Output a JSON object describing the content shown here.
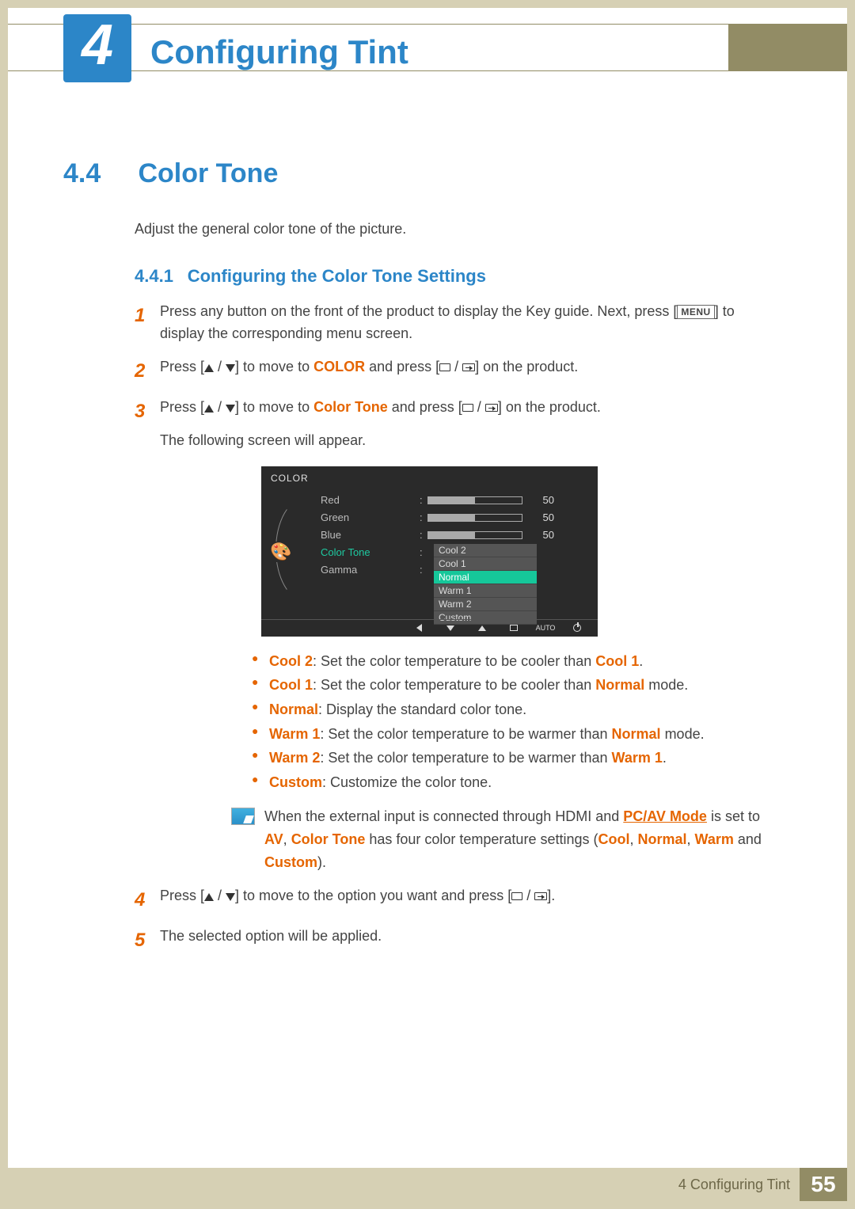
{
  "chapter": {
    "number": "4",
    "title": "Configuring Tint"
  },
  "section": {
    "number": "4.4",
    "title": "Color Tone"
  },
  "intro": "Adjust the general color tone of the picture.",
  "subsection": {
    "number": "4.4.1",
    "title": "Configuring the Color Tone Settings"
  },
  "steps": {
    "s1": {
      "num": "1",
      "a": "Press any button on the front of the product to display the Key guide. Next, press [",
      "menu": "MENU",
      "b": "] to display the corresponding menu screen."
    },
    "s2": {
      "num": "2",
      "a": "Press [",
      "b": "] to move to ",
      "c": "COLOR",
      "d": " and press [",
      "e": "] on the product."
    },
    "s3": {
      "num": "3",
      "a": "Press [",
      "b": "] to move to ",
      "c": "Color Tone",
      "d": " and press [",
      "e": "] on the product.",
      "f": "The following screen will appear."
    },
    "s4": {
      "num": "4",
      "a": "Press [",
      "b": "] to move to the option you want and press [",
      "c": "]."
    },
    "s5": {
      "num": "5",
      "a": "The selected option will be applied."
    }
  },
  "osd": {
    "title": "COLOR",
    "rows": [
      {
        "label": "Red",
        "value": "50"
      },
      {
        "label": "Green",
        "value": "50"
      },
      {
        "label": "Blue",
        "value": "50"
      }
    ],
    "sel_label": "Color Tone",
    "gamma_label": "Gamma",
    "options": [
      "Cool 2",
      "Cool 1",
      "Normal",
      "Warm 1",
      "Warm 2",
      "Custom"
    ],
    "selected": "Normal",
    "auto": "AUTO"
  },
  "bullets": {
    "b1": {
      "t": "Cool 2",
      "a": ": Set the color temperature to be cooler than ",
      "r": "Cool 1",
      "z": "."
    },
    "b2": {
      "t": "Cool 1",
      "a": ": Set the color temperature to be cooler than ",
      "r": "Normal",
      "z": " mode."
    },
    "b3": {
      "t": "Normal",
      "a": ": Display the standard color tone.",
      "r": "",
      "z": ""
    },
    "b4": {
      "t": "Warm 1",
      "a": ": Set the color temperature to be warmer than ",
      "r": "Normal",
      "z": " mode."
    },
    "b5": {
      "t": "Warm 2",
      "a": ": Set the color temperature to be warmer than ",
      "r": "Warm 1",
      "z": "."
    },
    "b6": {
      "t": "Custom",
      "a": ": Customize the color tone.",
      "r": "",
      "z": ""
    }
  },
  "note": {
    "a": "When the external input is connected through HDMI and ",
    "b": "PC/AV Mode",
    "c": " is set to ",
    "d": "AV",
    "e": ", ",
    "f": "Color Tone",
    "g": " has four color temperature settings (",
    "h": "Cool",
    "i": ", ",
    "j": "Normal",
    "k": ", ",
    "l": "Warm",
    "m": " and ",
    "n": "Custom",
    "o": ")."
  },
  "footer": {
    "text": "4 Configuring Tint",
    "page": "55"
  }
}
